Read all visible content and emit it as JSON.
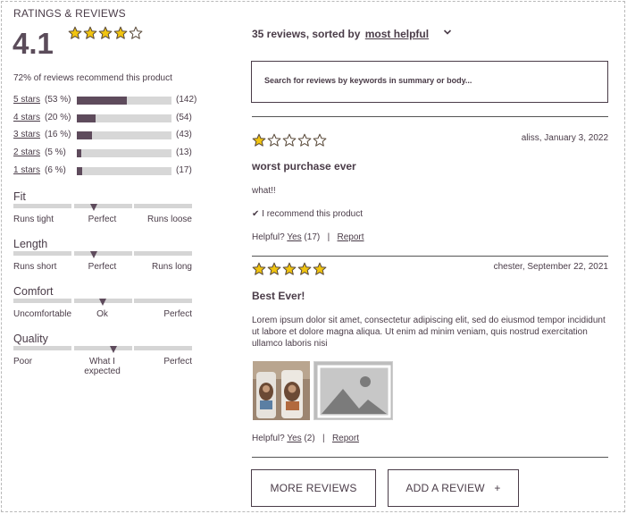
{
  "summary": {
    "title": "RATINGS & REVIEWS",
    "average": "4.1",
    "average_rating": 4.1,
    "recommend_text": "72% of reviews recommend this product",
    "breakdown": [
      {
        "label": "5 stars",
        "pct": "(53 %)",
        "count": "(142)",
        "fraction": 0.53
      },
      {
        "label": "4 stars",
        "pct": "(20 %)",
        "count": "(54)",
        "fraction": 0.2
      },
      {
        "label": "3 stars",
        "pct": "(16 %)",
        "count": "(43)",
        "fraction": 0.16
      },
      {
        "label": "2 stars",
        "pct": "(5 %)",
        "count": "(13)",
        "fraction": 0.05
      },
      {
        "label": "1 stars",
        "pct": "(6 %)",
        "count": "(17)",
        "fraction": 0.06
      }
    ],
    "attributes": [
      {
        "name": "Fit",
        "low": "Runs tight",
        "mid": "Perfect",
        "high": "Runs loose",
        "value": 0.45
      },
      {
        "name": "Length",
        "low": "Runs short",
        "mid": "Perfect",
        "high": "Runs long",
        "value": 0.45
      },
      {
        "name": "Comfort",
        "low": "Uncomfortable",
        "mid": "Ok",
        "high": "Perfect",
        "value": 0.5
      },
      {
        "name": "Quality",
        "low": "Poor",
        "mid": "What I expected",
        "high": "Perfect",
        "value": 0.56
      }
    ]
  },
  "sort": {
    "prefix": "35 reviews, sorted by",
    "selected": "most helpful"
  },
  "search": {
    "placeholder": "Search for reviews by keywords in summary or body..."
  },
  "reviews": [
    {
      "rating": 1,
      "meta": "aliss, January 3, 2022",
      "title": "worst purchase ever",
      "body": "what!!",
      "recommend": "✔ I recommend this product",
      "helpful_prefix": "Helpful?",
      "yes_label": "Yes",
      "yes_count": "(17)",
      "separator": "|",
      "report_label": "Report"
    },
    {
      "rating": 5,
      "meta": "chester, September 22, 2021",
      "title": "Best Ever!",
      "body": "Lorem ipsum dolor sit amet, consectetur adipiscing elit, sed do eiusmod tempor incididunt ut labore et dolore magna aliqua. Ut enim ad minim veniam, quis nostrud exercitation ullamco laboris nisi",
      "helpful_prefix": "Helpful?",
      "yes_label": "Yes",
      "yes_count": "(2)",
      "separator": "|",
      "report_label": "Report"
    }
  ],
  "buttons": {
    "more_reviews": "MORE REVIEWS",
    "add_review": "ADD A REVIEW   +"
  },
  "colors": {
    "accent": "#5e4b5c",
    "text": "#4a3c48",
    "star_fill": "#f1c40f",
    "track": "#d7d7d7"
  },
  "icons": [
    "star-icon",
    "chevron-down-icon",
    "check-icon",
    "image-placeholder-icon"
  ]
}
